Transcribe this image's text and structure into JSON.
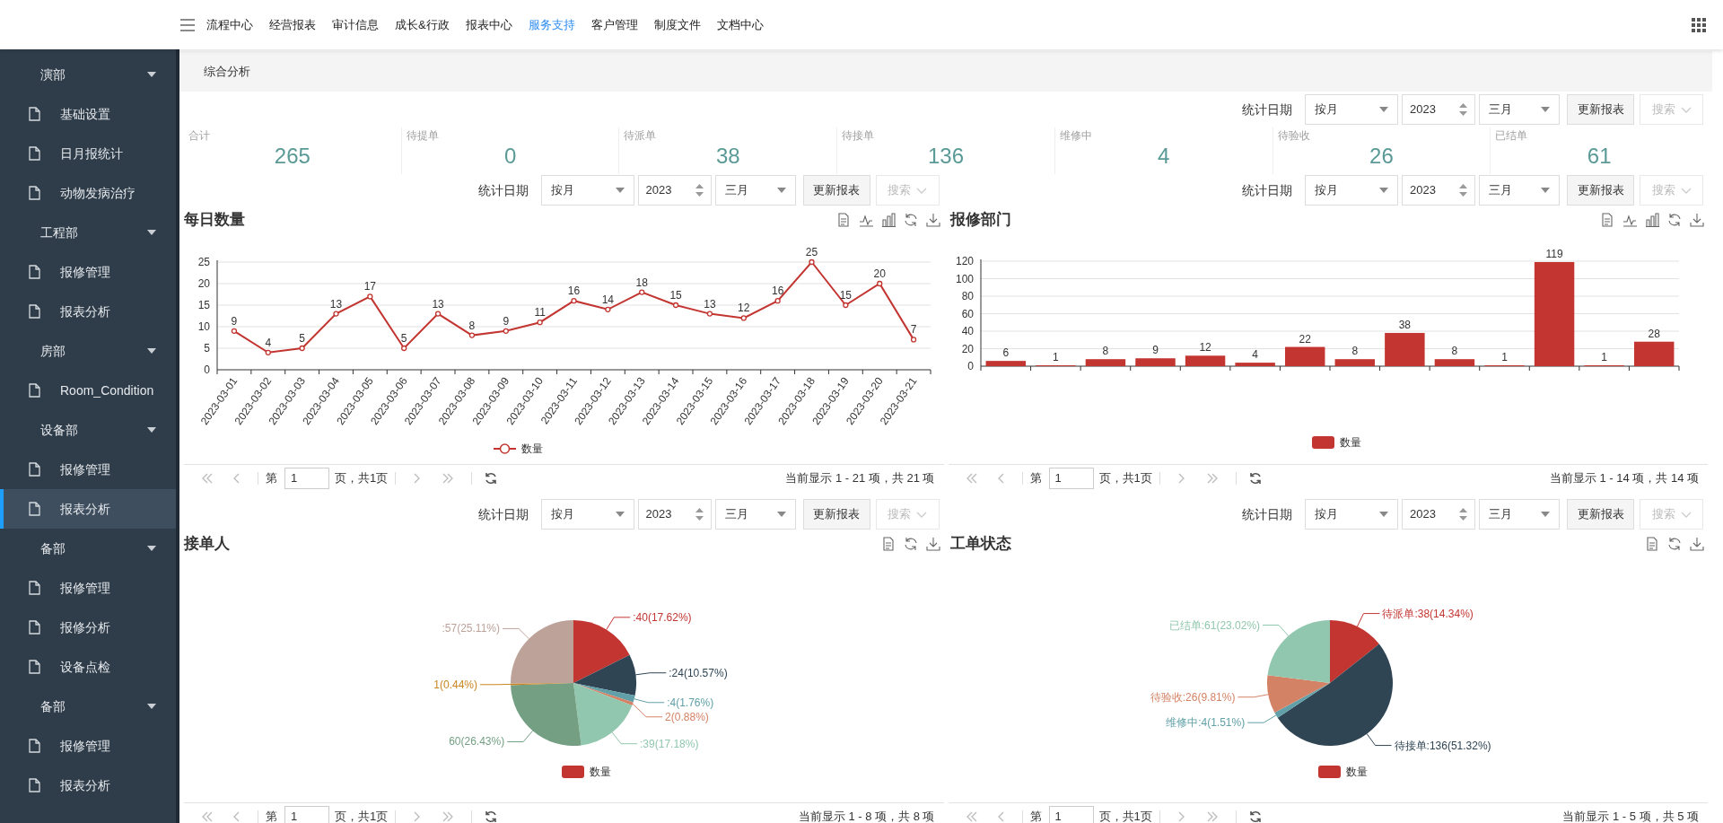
{
  "nav": {
    "items": [
      {
        "label": "流程中心",
        "selected": false
      },
      {
        "label": "经营报表",
        "selected": false
      },
      {
        "label": "审计信息",
        "selected": false
      },
      {
        "label": "成长&行政",
        "selected": false
      },
      {
        "label": "报表中心",
        "selected": false
      },
      {
        "label": "服务支持",
        "selected": true
      },
      {
        "label": "客户管理",
        "selected": false
      },
      {
        "label": "制度文件",
        "selected": false
      },
      {
        "label": "文档中心",
        "selected": false
      }
    ]
  },
  "sidebar": {
    "groups": [
      {
        "label": "演部",
        "expanded": true,
        "children": [
          {
            "label": "基础设置",
            "selected": false
          },
          {
            "label": "日月报统计",
            "selected": false
          },
          {
            "label": "动物发病治疗",
            "selected": false
          }
        ]
      },
      {
        "label": "工程部",
        "expanded": true,
        "children": [
          {
            "label": "报修管理",
            "selected": false
          },
          {
            "label": "报表分析",
            "selected": false
          }
        ]
      },
      {
        "label": "房部",
        "expanded": true,
        "children": [
          {
            "label": "Room_Condition",
            "selected": false
          }
        ]
      },
      {
        "label": "设备部",
        "expanded": true,
        "children": [
          {
            "label": "报修管理",
            "selected": false
          },
          {
            "label": "报表分析",
            "selected": true
          }
        ]
      },
      {
        "label": "备部",
        "expanded": true,
        "children": [
          {
            "label": "报修管理",
            "selected": false
          },
          {
            "label": "报修分析",
            "selected": false
          },
          {
            "label": "设备点检",
            "selected": false
          }
        ]
      },
      {
        "label": "备部",
        "expanded": true,
        "children": [
          {
            "label": "报修管理",
            "selected": false
          },
          {
            "label": "报表分析",
            "selected": false
          }
        ]
      }
    ]
  },
  "breadcrumb": "综合分析",
  "top_filter": {
    "label": "统计日期",
    "mode": "按月",
    "year": "2023",
    "month": "三月",
    "update": "更新报表",
    "search": "搜索"
  },
  "stats": [
    {
      "label": "合计",
      "value": "265"
    },
    {
      "label": "待提单",
      "value": "0"
    },
    {
      "label": "待派单",
      "value": "38"
    },
    {
      "label": "待接单",
      "value": "136"
    },
    {
      "label": "维修中",
      "value": "4"
    },
    {
      "label": "待验收",
      "value": "26"
    },
    {
      "label": "已结单",
      "value": "61"
    }
  ],
  "panels": [
    {
      "title": "每日数量",
      "filter": {
        "label": "统计日期",
        "mode": "按月",
        "year": "2023",
        "month": "三月",
        "update": "更新报表",
        "search": "搜索"
      },
      "chart_data": {
        "type": "line",
        "categories": [
          "2023-03-01",
          "2023-03-02",
          "2023-03-03",
          "2023-03-04",
          "2023-03-05",
          "2023-03-06",
          "2023-03-07",
          "2023-03-08",
          "2023-03-09",
          "2023-03-10",
          "2023-03-11",
          "2023-03-12",
          "2023-03-13",
          "2023-03-14",
          "2023-03-15",
          "2023-03-16",
          "2023-03-17",
          "2023-03-18",
          "2023-03-19",
          "2023-03-20",
          "2023-03-21"
        ],
        "series": [
          {
            "name": "数量",
            "color": "#c23531",
            "marker": "circle",
            "values": [
              9,
              4,
              5,
              13,
              17,
              5,
              13,
              8,
              9,
              11,
              16,
              14,
              18,
              15,
              13,
              12,
              16,
              25,
              15,
              20,
              7
            ]
          }
        ],
        "yticks": [
          0,
          5,
          10,
          15,
          20,
          25
        ],
        "ylim": [
          0,
          25
        ],
        "grid": true,
        "data_labels": true
      },
      "pagination": {
        "prefix": "第",
        "page": "1",
        "suffix": "页，共1页",
        "summary": "当前显示 1 - 21 项，共 21 项"
      }
    },
    {
      "title": "报修部门",
      "filter": {
        "label": "统计日期",
        "mode": "按月",
        "year": "2023",
        "month": "三月",
        "update": "更新报表",
        "search": "搜索"
      },
      "chart_data": {
        "type": "bar",
        "series": [
          {
            "name": "数量",
            "color": "#c23531",
            "values": [
              6,
              1,
              8,
              9,
              12,
              4,
              22,
              8,
              38,
              8,
              1,
              119,
              1,
              28
            ]
          }
        ],
        "yticks": [
          0,
          20,
          40,
          60,
          80,
          100,
          120
        ],
        "ylim": [
          0,
          120
        ],
        "grid": true,
        "data_labels": true
      },
      "pagination": {
        "prefix": "第",
        "page": "1",
        "suffix": "页，共1页",
        "summary": "当前显示 1 - 14 项，共 14 项"
      }
    },
    {
      "title": "接单人",
      "filter": {
        "label": "统计日期",
        "mode": "按月",
        "year": "2023",
        "month": "三月",
        "update": "更新报表",
        "search": "搜索"
      },
      "chart_data": {
        "type": "pie",
        "colors": [
          "#c23531",
          "#2f4554",
          "#61a0a8",
          "#d48265",
          "#91c7ae",
          "#749f83",
          "#ca8622",
          "#bda29a"
        ],
        "series": [
          {
            "name": "数量",
            "values": [
              17.62,
              10.57,
              1.76,
              0.88,
              17.18,
              26.43,
              0.44,
              25.11
            ]
          }
        ],
        "value_labels": [
          ":40(17.62%)",
          ":24(10.57%)",
          ":4(1.76%)",
          "2(0.88%)",
          ":39(17.18%)",
          "60(26.43%)",
          "1(0.44%)",
          ":57(25.11%)"
        ]
      },
      "pagination": {
        "prefix": "第",
        "page": "1",
        "suffix": "页，共1页",
        "summary": "当前显示 1 - 8 项，共 8 项"
      }
    },
    {
      "title": "工单状态",
      "filter": {
        "label": "统计日期",
        "mode": "按月",
        "year": "2023",
        "month": "三月",
        "update": "更新报表",
        "search": "搜索"
      },
      "chart_data": {
        "type": "pie",
        "colors": [
          "#c23531",
          "#2f4554",
          "#61a0a8",
          "#d48265",
          "#91c7ae"
        ],
        "series": [
          {
            "name": "数量",
            "values": [
              14.34,
              51.32,
              1.51,
              9.81,
              23.02
            ]
          }
        ],
        "value_labels": [
          "待派单:38(14.34%)",
          "待接单:136(51.32%)",
          "维修中:4(1.51%)",
          "待验收:26(9.81%)",
          "已结单:61(23.02%)"
        ]
      },
      "pagination": {
        "prefix": "第",
        "page": "1",
        "suffix": "页，共1页",
        "summary": "当前显示 1 - 5 项，共 5 项"
      }
    }
  ]
}
